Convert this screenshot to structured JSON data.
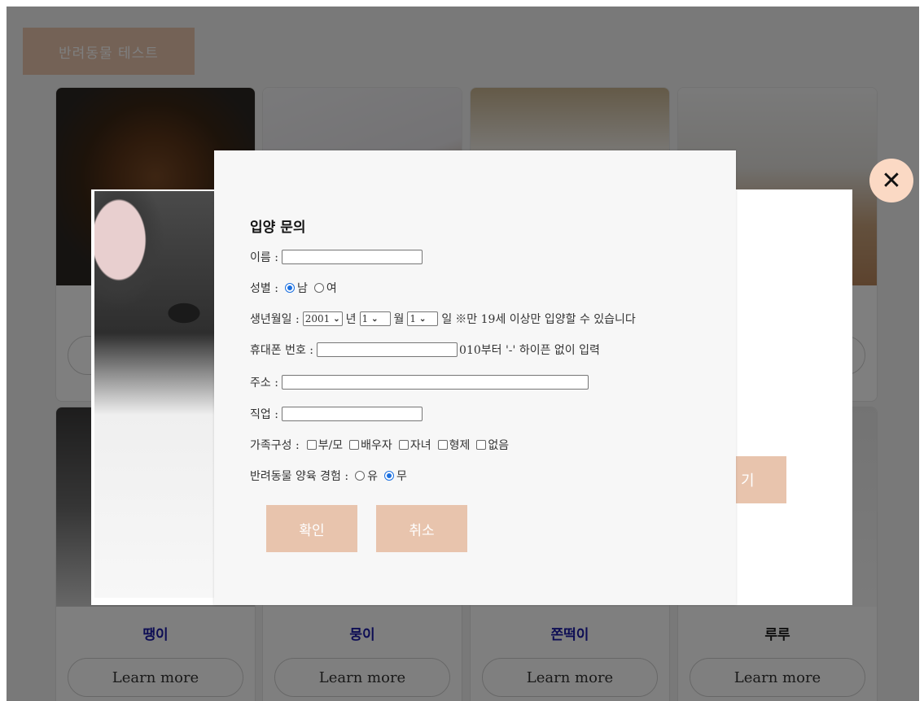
{
  "header": {
    "button_label": "반려동물 테스트"
  },
  "cards": [
    {
      "name": "땡이",
      "button": "Learn more"
    },
    {
      "name": "뭉이",
      "button": "Learn more"
    },
    {
      "name": "쫀떡이",
      "button": "Learn more"
    },
    {
      "name": "루루",
      "button": "Learn more"
    }
  ],
  "background_modal": {
    "adopt_button_partial": "기"
  },
  "form": {
    "title": "입양 문의",
    "name_label": "이름 :",
    "gender_label": "성별 :",
    "gender_options": [
      "남",
      "여"
    ],
    "gender_selected": "남",
    "birth_label": "생년월일 :",
    "birth_year": "2001",
    "year_suffix": "년",
    "birth_month": "1",
    "month_suffix": "월",
    "birth_day": "1",
    "day_suffix": "일",
    "age_note": "※만 19세 이상만 입양할 수 있습니다",
    "phone_label": "휴대폰 번호 :",
    "phone_hint": "010부터 '-' 하이픈 없이 입력",
    "address_label": "주소 :",
    "job_label": "직업 :",
    "family_label": "가족구성 :",
    "family_options": [
      "부/모",
      "배우자",
      "자녀",
      "형제",
      "없음"
    ],
    "experience_label": "반려동물 양육 경험 :",
    "experience_options": [
      "유",
      "무"
    ],
    "experience_selected": "무",
    "confirm_button": "확인",
    "cancel_button": "취소"
  },
  "close_icon": "close-icon",
  "colors": {
    "accent": "#e8c4ad",
    "name_blue": "#1a1aa8",
    "close_bg": "#fbd9c4",
    "radio": "#1a6fe0"
  }
}
